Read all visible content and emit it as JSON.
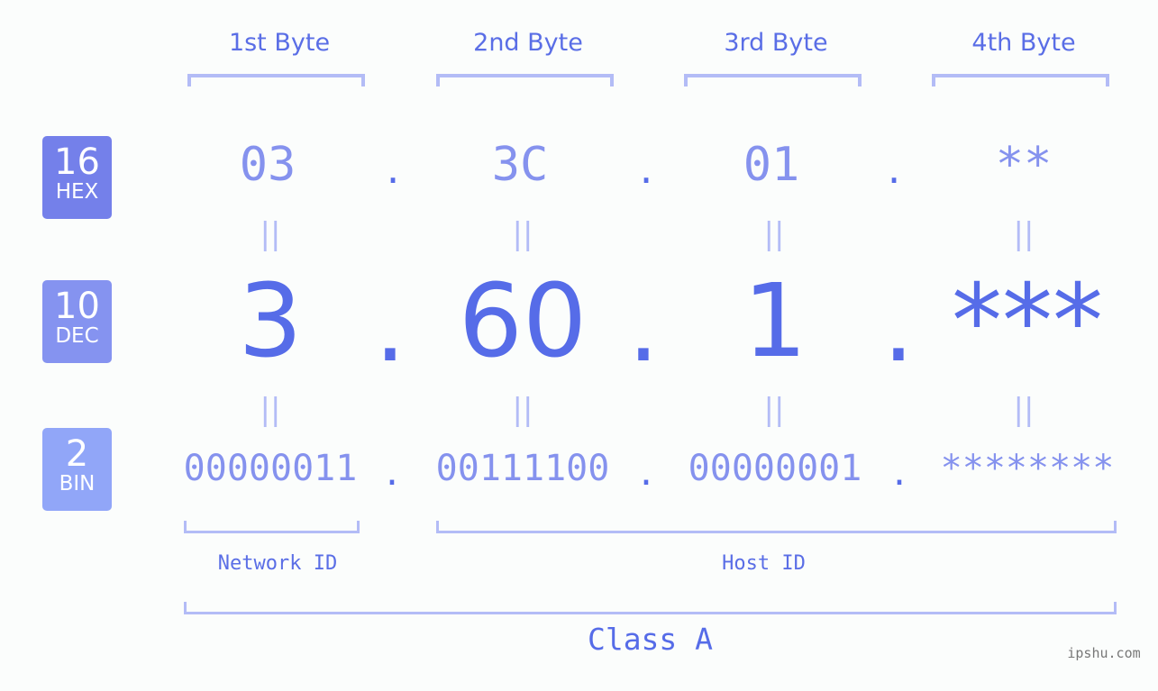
{
  "bytes": {
    "headers": [
      "1st Byte",
      "2nd Byte",
      "3rd Byte",
      "4th Byte"
    ]
  },
  "badges": {
    "hex": {
      "number": "16",
      "label": "HEX",
      "color": "#7480ea"
    },
    "dec": {
      "number": "10",
      "label": "DEC",
      "color": "#8593f0"
    },
    "bin": {
      "number": "2",
      "label": "BIN",
      "color": "#91a6f8"
    }
  },
  "hex": {
    "values": [
      "03",
      "3C",
      "01",
      "**"
    ],
    "separator": "."
  },
  "dec": {
    "values": [
      "3",
      "60",
      "1",
      "***"
    ],
    "separator": "."
  },
  "bin": {
    "values": [
      "00000011",
      "00111100",
      "00000001",
      "********"
    ],
    "separator": "."
  },
  "equals_glyph": "||",
  "segments": {
    "network_id": "Network ID",
    "host_id": "Host ID",
    "class": "Class A"
  },
  "watermark": "ipshu.com",
  "colors": {
    "accent": "#566ce8",
    "light_accent": "#8592ee",
    "bracket": "#b3bcf6",
    "background": "#fbfdfc"
  }
}
